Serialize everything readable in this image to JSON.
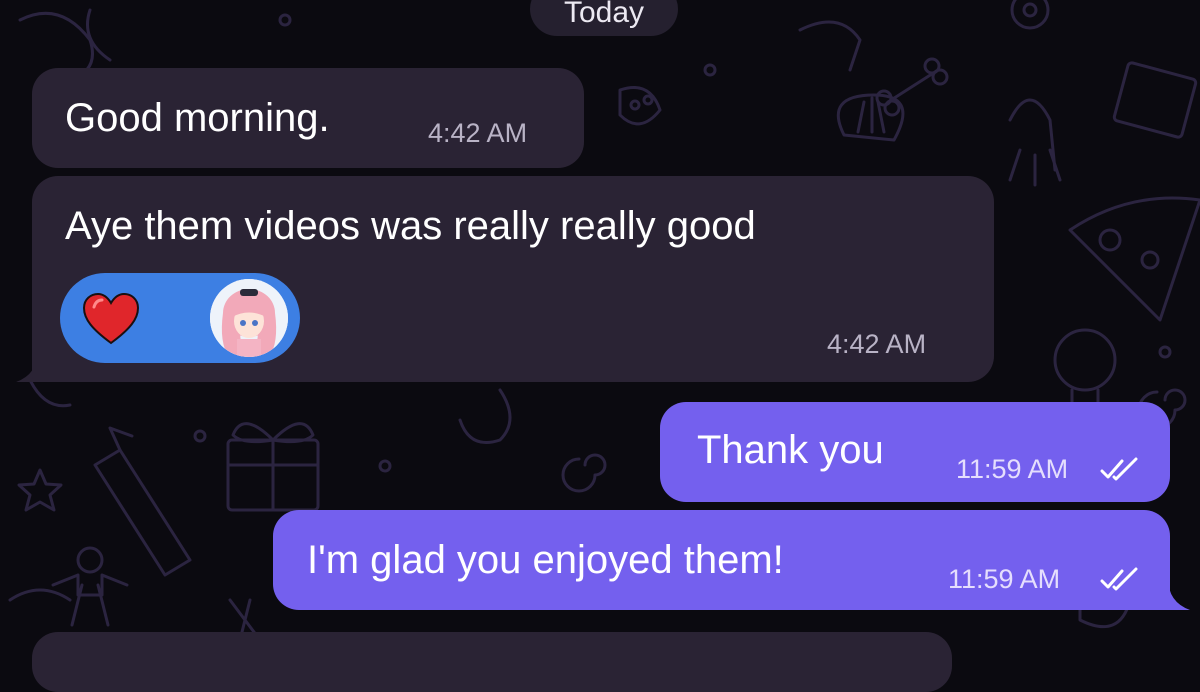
{
  "chat": {
    "date_label": "Today",
    "messages": [
      {
        "direction": "incoming",
        "text": "Good morning.",
        "time": "4:42 AM"
      },
      {
        "direction": "incoming",
        "text": "Aye them videos was really really good",
        "time": "4:42 AM",
        "reactions": [
          {
            "emoji": "red-heart",
            "reactor": "avatar-pink-hair-anime"
          }
        ]
      },
      {
        "direction": "outgoing",
        "text": "Thank you",
        "time": "11:59 AM",
        "status": "read"
      },
      {
        "direction": "outgoing",
        "text": "I'm glad you enjoyed them!",
        "time": "11:59 AM",
        "status": "read"
      }
    ]
  },
  "colors": {
    "background": "#0b0a10",
    "incoming_bubble": "#2a2334",
    "outgoing_bubble": "#7460ee",
    "reaction_pill": "#3d7fe3",
    "heart": "#e0262b"
  },
  "icons": {
    "read_status": "double-check-icon",
    "reaction": "heart-icon"
  }
}
